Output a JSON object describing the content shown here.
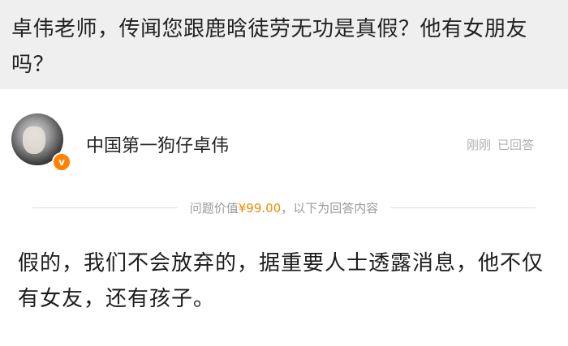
{
  "question": {
    "text": "卓伟老师，传闻您跟鹿晗徒劳无功是真假？他有女朋友吗？"
  },
  "answer": {
    "author_name": "中国第一狗仔卓伟",
    "verified_icon": "verified-v-badge",
    "time": "刚刚",
    "status": "已回答",
    "price_prefix": "问题价值",
    "price_value": "¥99.00",
    "price_suffix": "，以下为回答内容",
    "content": "假的，我们不会放弃的，据重要人士透露消息，他不仅有女友，还有孩子。"
  },
  "colors": {
    "question_background": "#efefef",
    "price_accent": "#f08a00",
    "verified_badge": "#ff8200",
    "meta_gray": "#b0b0b0"
  }
}
